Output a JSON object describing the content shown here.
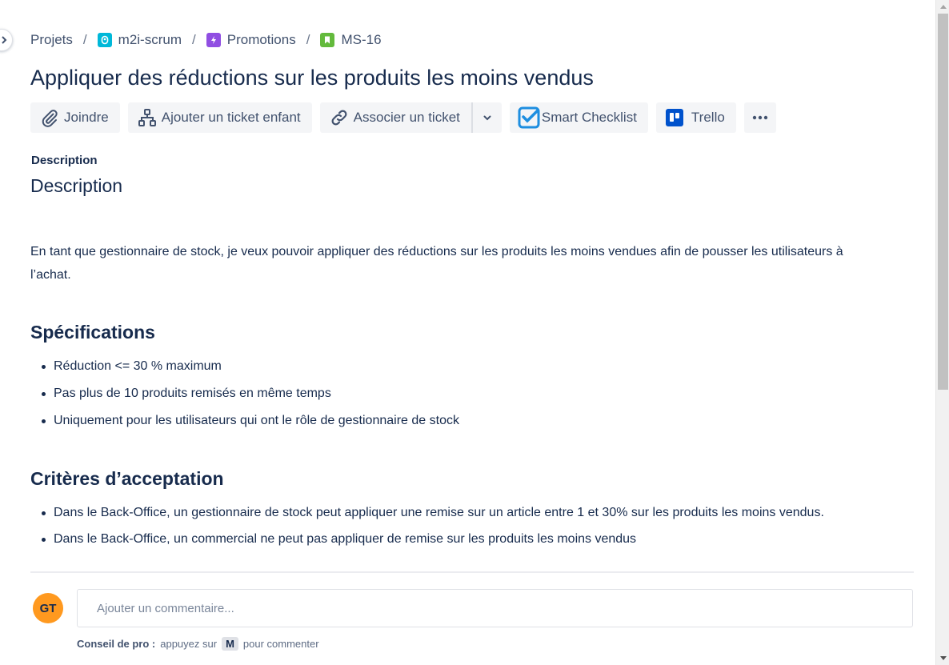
{
  "breadcrumb": {
    "items": [
      {
        "label": "Projets",
        "icon": "none"
      },
      {
        "label": "m2i-scrum",
        "icon": "project-icon"
      },
      {
        "label": "Promotions",
        "icon": "epic-lightning-icon"
      },
      {
        "label": "MS-16",
        "icon": "story-bookmark-icon"
      }
    ],
    "separator": "/"
  },
  "issue": {
    "title": "Appliquer des réductions sur les produits les moins vendus"
  },
  "toolbar": {
    "attach_label": "Joindre",
    "child_label": "Ajouter un ticket enfant",
    "link_label": "Associer un ticket",
    "checklist_label": "Smart Checklist",
    "trello_label": "Trello",
    "more_label": "•••"
  },
  "description": {
    "field_label": "Description",
    "heading": "Description",
    "paragraph": "En tant que gestionnaire de stock, je veux pouvoir appliquer des réductions sur les produits les moins vendues afin de pousser les utilisateurs à l’achat.",
    "specs_heading": "Spécifications",
    "specs": [
      "Réduction <= 30 % maximum",
      "Pas plus de 10 produits remisés en même temps",
      "Uniquement pour les utilisateurs qui ont le rôle de gestionnaire de stock"
    ],
    "criteria_heading": "Critères d’acceptation",
    "criteria": [
      "Dans le Back-Office, un gestionnaire de stock peut appliquer une remise sur un article entre 1 et 30% sur les produits les moins vendus.",
      "Dans le Back-Office, un commercial ne peut pas appliquer de remise sur les produits les moins vendus"
    ]
  },
  "comment": {
    "avatar_initials": "GT",
    "placeholder": "Ajouter un commentaire...",
    "tip_bold": "Conseil de pro :",
    "tip_before": "appuyez sur",
    "tip_key": "M",
    "tip_after": "pour commenter"
  },
  "colors": {
    "text": "#172b4d",
    "avatar": "#ff991f",
    "project_icon": "#00b8d9",
    "epic_icon": "#904ee2",
    "story_icon": "#63ba3c",
    "checklist_icon": "#1e8ee0",
    "trello_icon": "#0052cc"
  }
}
